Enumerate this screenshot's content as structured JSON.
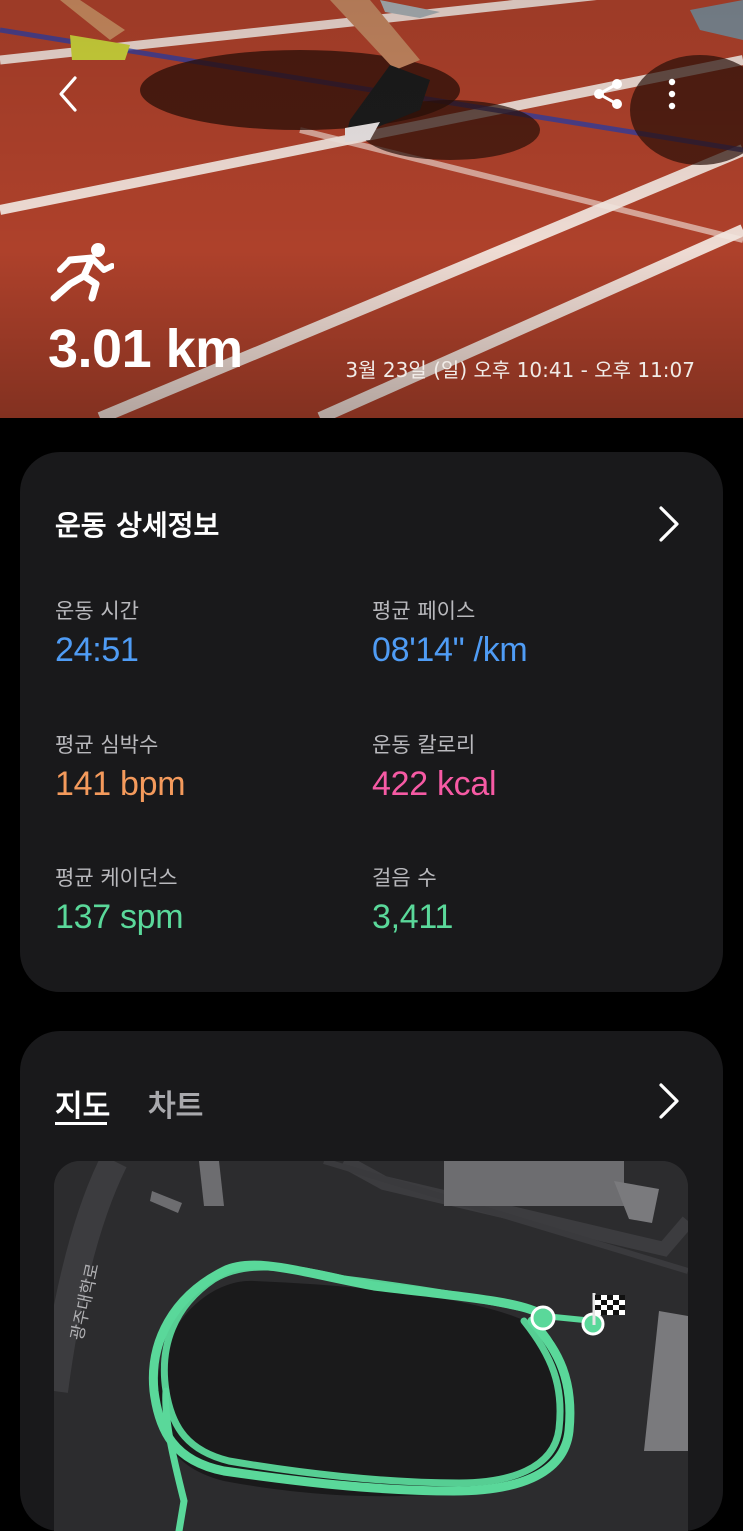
{
  "header": {
    "back_icon": "chevron-left-icon",
    "share_icon": "share-icon",
    "more_icon": "more-vertical-icon",
    "activity_icon": "running-icon",
    "distance": "3.01 km",
    "datetime": "3월 23일 (일) 오후 10:41 - 오후 11:07"
  },
  "details": {
    "title": "운동 상세정보",
    "stats": [
      {
        "label": "운동 시간",
        "value": "24:51",
        "color": "#4f9cf5"
      },
      {
        "label": "평균 페이스",
        "value": "08'14\" /km",
        "color": "#4f9cf5"
      },
      {
        "label": "평균 심박수",
        "value": "141 bpm",
        "color": "#f49a5c"
      },
      {
        "label": "운동 칼로리",
        "value": "422 kcal",
        "color": "#f65aa4"
      },
      {
        "label": "평균 케이던스",
        "value": "137 spm",
        "color": "#5ad89a"
      },
      {
        "label": "걸음 수",
        "value": "3,411",
        "color": "#5ad89a"
      }
    ]
  },
  "map_section": {
    "tabs": [
      {
        "label": "지도",
        "selected": true
      },
      {
        "label": "차트",
        "selected": false
      }
    ],
    "street_label": "광주대학로",
    "route_color": "#5ad89a",
    "finish_icon": "checkered-flag-icon"
  }
}
